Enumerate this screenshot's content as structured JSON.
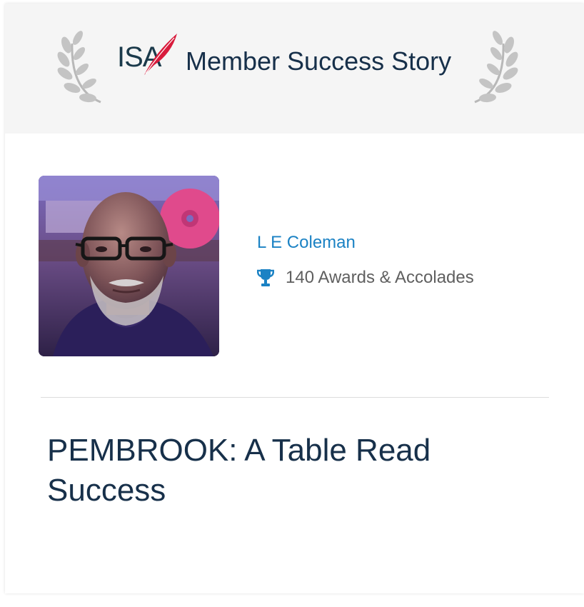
{
  "header": {
    "logo_text": "IS",
    "logo_last_letter": "A",
    "title": "Member Success Story"
  },
  "member": {
    "name": "L E Coleman",
    "awards_text": "140 Awards & Accolades",
    "awards_icon": "trophy-icon"
  },
  "story": {
    "title": "PEMBROOK: A Table Read Success"
  },
  "colors": {
    "header_bg": "#f5f5f5",
    "title_text": "#17304a",
    "link_blue": "#1b82c4",
    "logo_red": "#d81b3c",
    "muted_text": "#5f5f5f"
  }
}
